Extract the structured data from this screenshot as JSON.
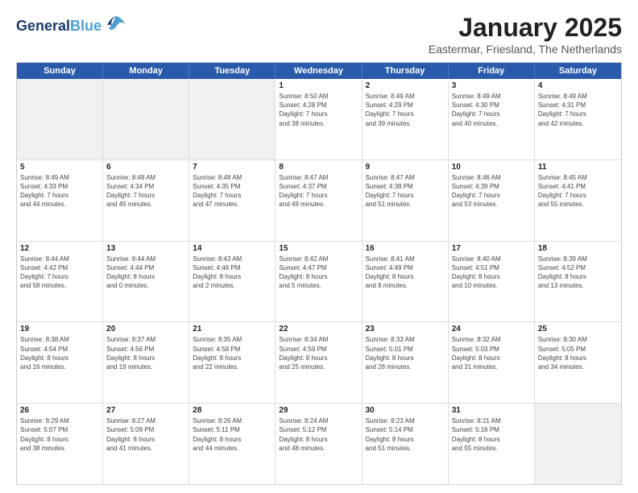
{
  "logo": {
    "general": "General",
    "blue": "Blue"
  },
  "title": "January 2025",
  "subtitle": "Eastermar, Friesland, The Netherlands",
  "header_days": [
    "Sunday",
    "Monday",
    "Tuesday",
    "Wednesday",
    "Thursday",
    "Friday",
    "Saturday"
  ],
  "weeks": [
    [
      {
        "day": "",
        "info": ""
      },
      {
        "day": "",
        "info": ""
      },
      {
        "day": "",
        "info": ""
      },
      {
        "day": "1",
        "info": "Sunrise: 8:50 AM\nSunset: 4:28 PM\nDaylight: 7 hours\nand 38 minutes."
      },
      {
        "day": "2",
        "info": "Sunrise: 8:49 AM\nSunset: 4:29 PM\nDaylight: 7 hours\nand 39 minutes."
      },
      {
        "day": "3",
        "info": "Sunrise: 8:49 AM\nSunset: 4:30 PM\nDaylight: 7 hours\nand 40 minutes."
      },
      {
        "day": "4",
        "info": "Sunrise: 8:49 AM\nSunset: 4:31 PM\nDaylight: 7 hours\nand 42 minutes."
      }
    ],
    [
      {
        "day": "5",
        "info": "Sunrise: 8:49 AM\nSunset: 4:33 PM\nDaylight: 7 hours\nand 44 minutes."
      },
      {
        "day": "6",
        "info": "Sunrise: 8:48 AM\nSunset: 4:34 PM\nDaylight: 7 hours\nand 45 minutes."
      },
      {
        "day": "7",
        "info": "Sunrise: 8:48 AM\nSunset: 4:35 PM\nDaylight: 7 hours\nand 47 minutes."
      },
      {
        "day": "8",
        "info": "Sunrise: 8:47 AM\nSunset: 4:37 PM\nDaylight: 7 hours\nand 49 minutes."
      },
      {
        "day": "9",
        "info": "Sunrise: 8:47 AM\nSunset: 4:38 PM\nDaylight: 7 hours\nand 51 minutes."
      },
      {
        "day": "10",
        "info": "Sunrise: 8:46 AM\nSunset: 4:39 PM\nDaylight: 7 hours\nand 53 minutes."
      },
      {
        "day": "11",
        "info": "Sunrise: 8:45 AM\nSunset: 4:41 PM\nDaylight: 7 hours\nand 55 minutes."
      }
    ],
    [
      {
        "day": "12",
        "info": "Sunrise: 8:44 AM\nSunset: 4:42 PM\nDaylight: 7 hours\nand 58 minutes."
      },
      {
        "day": "13",
        "info": "Sunrise: 8:44 AM\nSunset: 4:44 PM\nDaylight: 8 hours\nand 0 minutes."
      },
      {
        "day": "14",
        "info": "Sunrise: 8:43 AM\nSunset: 4:46 PM\nDaylight: 8 hours\nand 2 minutes."
      },
      {
        "day": "15",
        "info": "Sunrise: 8:42 AM\nSunset: 4:47 PM\nDaylight: 8 hours\nand 5 minutes."
      },
      {
        "day": "16",
        "info": "Sunrise: 8:41 AM\nSunset: 4:49 PM\nDaylight: 8 hours\nand 8 minutes."
      },
      {
        "day": "17",
        "info": "Sunrise: 8:40 AM\nSunset: 4:51 PM\nDaylight: 8 hours\nand 10 minutes."
      },
      {
        "day": "18",
        "info": "Sunrise: 8:39 AM\nSunset: 4:52 PM\nDaylight: 8 hours\nand 13 minutes."
      }
    ],
    [
      {
        "day": "19",
        "info": "Sunrise: 8:38 AM\nSunset: 4:54 PM\nDaylight: 8 hours\nand 16 minutes."
      },
      {
        "day": "20",
        "info": "Sunrise: 8:37 AM\nSunset: 4:56 PM\nDaylight: 8 hours\nand 19 minutes."
      },
      {
        "day": "21",
        "info": "Sunrise: 8:35 AM\nSunset: 4:58 PM\nDaylight: 8 hours\nand 22 minutes."
      },
      {
        "day": "22",
        "info": "Sunrise: 8:34 AM\nSunset: 4:59 PM\nDaylight: 8 hours\nand 25 minutes."
      },
      {
        "day": "23",
        "info": "Sunrise: 8:33 AM\nSunset: 5:01 PM\nDaylight: 8 hours\nand 28 minutes."
      },
      {
        "day": "24",
        "info": "Sunrise: 8:32 AM\nSunset: 5:03 PM\nDaylight: 8 hours\nand 31 minutes."
      },
      {
        "day": "25",
        "info": "Sunrise: 8:30 AM\nSunset: 5:05 PM\nDaylight: 8 hours\nand 34 minutes."
      }
    ],
    [
      {
        "day": "26",
        "info": "Sunrise: 8:29 AM\nSunset: 5:07 PM\nDaylight: 8 hours\nand 38 minutes."
      },
      {
        "day": "27",
        "info": "Sunrise: 8:27 AM\nSunset: 5:09 PM\nDaylight: 8 hours\nand 41 minutes."
      },
      {
        "day": "28",
        "info": "Sunrise: 8:26 AM\nSunset: 5:11 PM\nDaylight: 8 hours\nand 44 minutes."
      },
      {
        "day": "29",
        "info": "Sunrise: 8:24 AM\nSunset: 5:12 PM\nDaylight: 8 hours\nand 48 minutes."
      },
      {
        "day": "30",
        "info": "Sunrise: 8:23 AM\nSunset: 5:14 PM\nDaylight: 8 hours\nand 51 minutes."
      },
      {
        "day": "31",
        "info": "Sunrise: 8:21 AM\nSunset: 5:16 PM\nDaylight: 8 hours\nand 55 minutes."
      },
      {
        "day": "",
        "info": ""
      }
    ]
  ]
}
